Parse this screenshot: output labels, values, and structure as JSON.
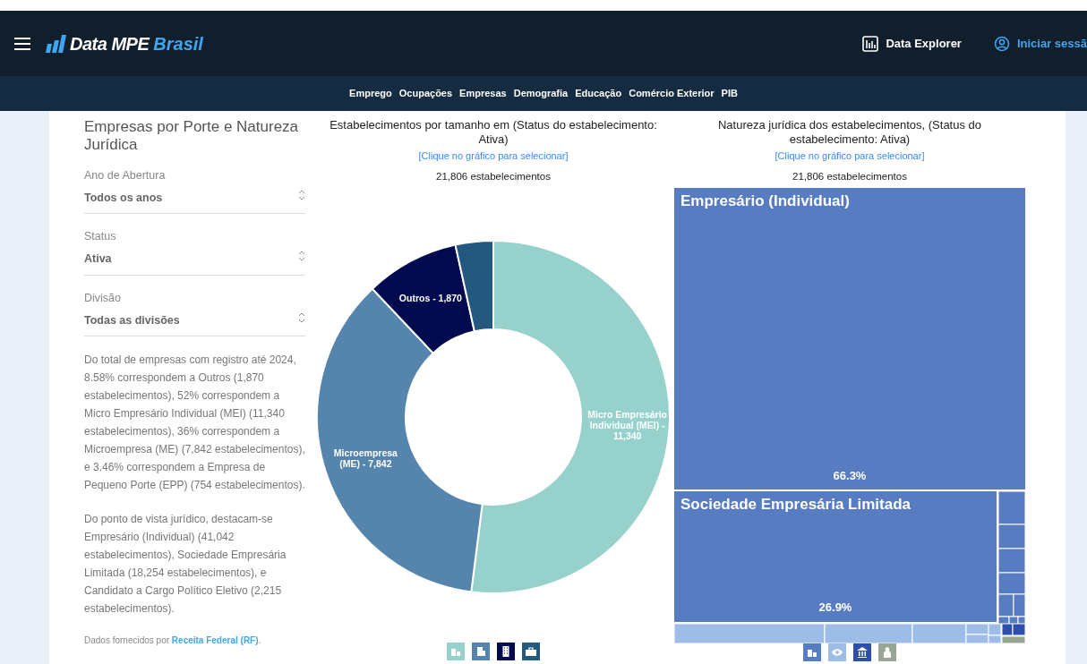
{
  "header": {
    "logo": {
      "word": "Data MPE",
      "accent": "Brasil"
    },
    "actions": [
      {
        "kind": "explorer",
        "label": "Data Explorer"
      },
      {
        "kind": "login",
        "label": "Iniciar sessã"
      }
    ]
  },
  "subnav": [
    "Emprego",
    "Ocupações",
    "Empresas",
    "Demografia",
    "Educação",
    "Comércio Exterior",
    "PIB"
  ],
  "sidebar": {
    "title": "Empresas por Porte e Natureza Jurídica",
    "filters": [
      {
        "label": "Ano de Abertura",
        "value": "Todos os anos"
      },
      {
        "label": "Status",
        "value": "Ativa"
      },
      {
        "label": "Divisão",
        "value": "Todas as divisões"
      }
    ],
    "paragraphs": [
      "Do total de empresas com registro até 2024, 8.58% correspondem a Outros (1,870 estabelecimentos), 52% correspondem a Micro Empresário Individual (MEI) (11,340 estabelecimentos), 36% correspondem a Microempresa (ME) (7,842 estabelecimentos), e 3.46% correspondem a Empresa de Pequeno Porte (EPP) (754 estabelecimentos).",
      "Do ponto de vista jurídico, destacam-se Empresário (Individual) (41,042 estabelecimentos), Sociedade Empresária Limitada (18,254 estabelecimentos), e Candidato a Cargo Político Eletivo (2,215 estabelecimentos)."
    ],
    "source": {
      "text": "Dados fornecidos por",
      "link": "Receita Federal (RF)",
      "end": "."
    }
  },
  "donut_panel": {
    "title": "Estabelecimentos por tamanho em (Status do estabelecimento: Ativa)",
    "hint": "[Clique no gráfico para selecionar]",
    "total": "21,806 estabelecimentos",
    "chart_data": {
      "type": "donut",
      "categories": [
        "Micro Empresário Individual (MEI) -",
        "Microempresa (ME) -",
        "Outros -",
        null
      ],
      "values": [
        11340,
        7842,
        1870,
        754
      ],
      "value_labels": [
        "11,340",
        "7,842",
        "1,870",
        null
      ],
      "colors": [
        "#96d1cc",
        "#5584ad",
        "#010a4f",
        "#23587f"
      ]
    },
    "legend": [
      {
        "kind": "buildings",
        "color": "#96d1cc"
      },
      {
        "kind": "tower",
        "color": "#5584ad"
      },
      {
        "kind": "office",
        "color": "#010a4f"
      },
      {
        "kind": "briefcase",
        "color": "#23587f"
      }
    ]
  },
  "treemap_panel": {
    "title": "Natureza jurídica dos estabelecimentos, (Status do estabelecimento: Ativa)",
    "hint": "[Clique no gráfico para selecionar]",
    "total": "21,806 estabelecimentos",
    "tiles": [
      {
        "label": "Empresário (Individual)",
        "share": "66.3%"
      },
      {
        "label": "Sociedade Empresária Limitada",
        "share": "26.9%"
      }
    ],
    "legend": [
      {
        "kind": "buildings",
        "color": "#577cc2"
      },
      {
        "kind": "eye",
        "color": "#9dbde6"
      },
      {
        "kind": "bank",
        "color": "#2f4fae"
      },
      {
        "kind": "person",
        "color": "#97a593"
      }
    ]
  }
}
